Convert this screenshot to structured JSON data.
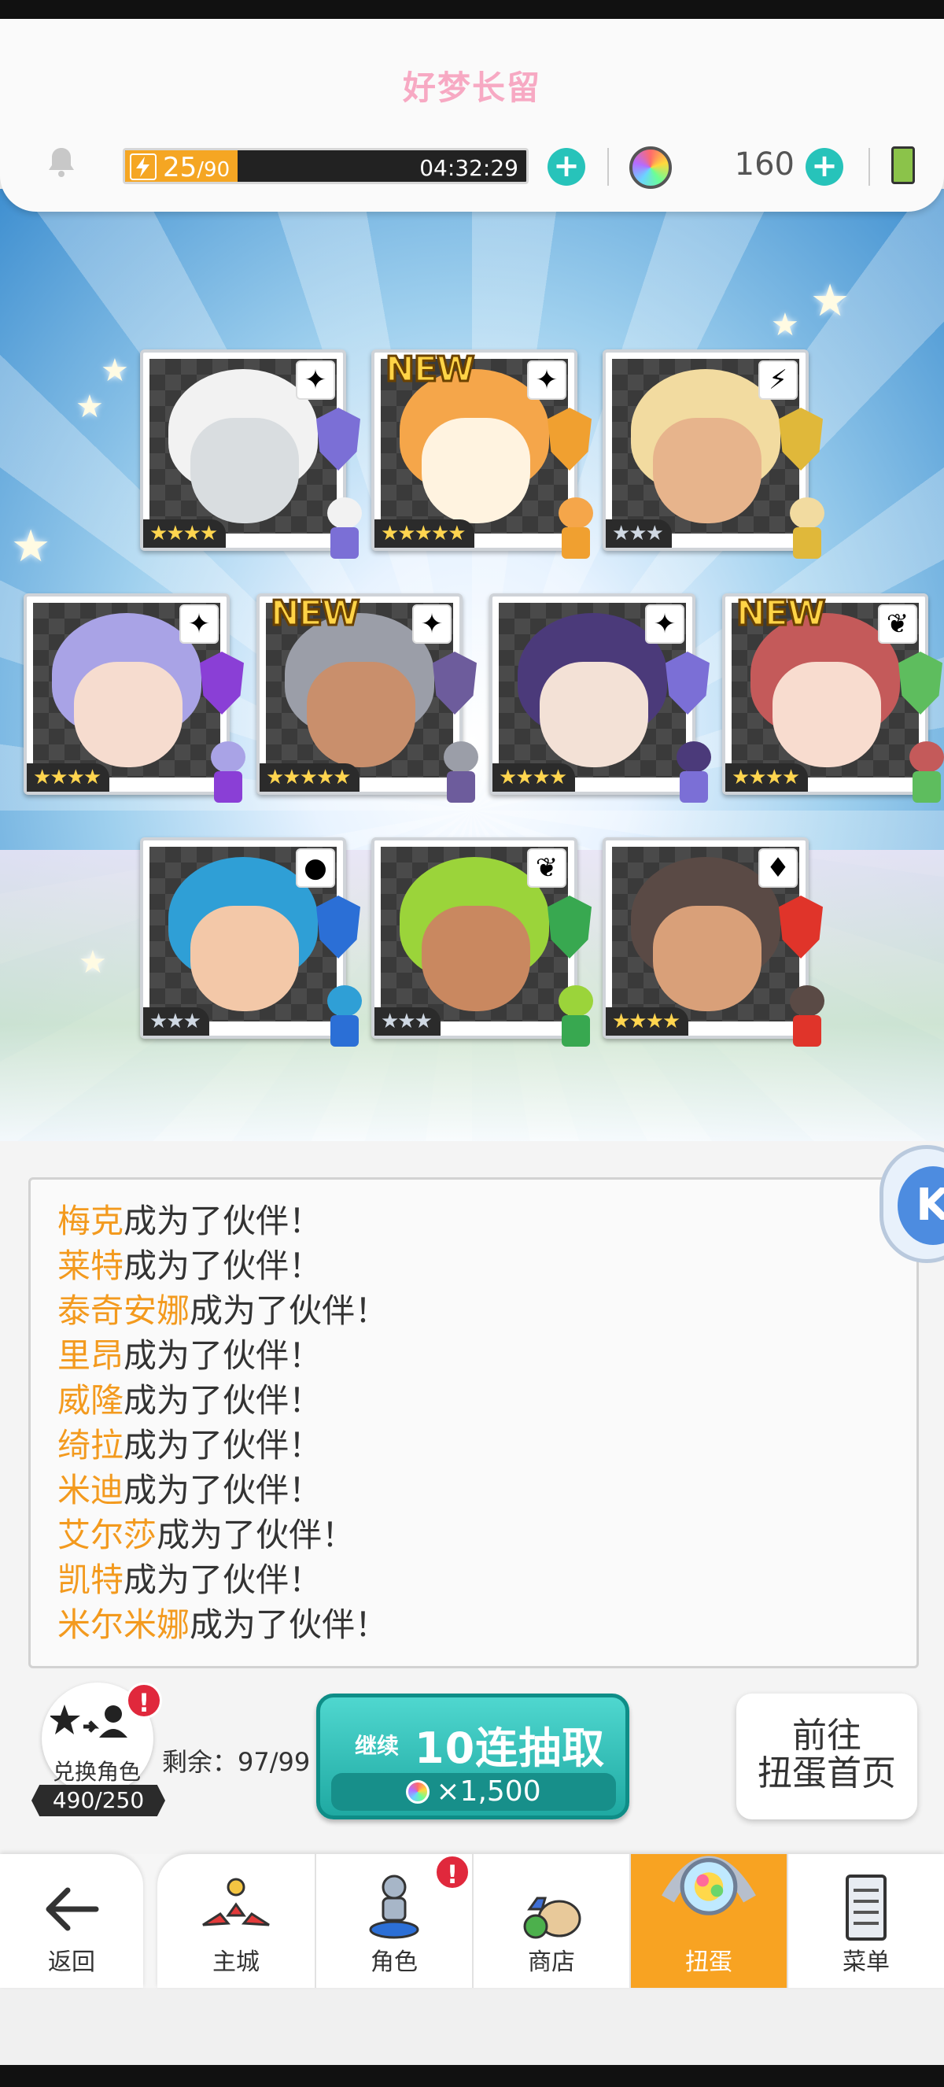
{
  "header": {
    "title": "好梦长留",
    "stamina_value": "25",
    "stamina_max": "/90",
    "stamina_fraction": 0.28,
    "stamina_timer": "04:32:29",
    "gem_count": "160"
  },
  "cards": [
    {
      "stars": "★★★★",
      "new": "",
      "rarity": 4,
      "element": "✦",
      "hair": "#f2f2f2",
      "skin": "#d9dde0",
      "crest": "#7b6fd6"
    },
    {
      "stars": "★★★★★",
      "new": "NEW",
      "rarity": 5,
      "element": "✦",
      "hair": "#f5a64a",
      "skin": "#fff3e0",
      "crest": "#f0a030"
    },
    {
      "stars": "★★★",
      "new": "",
      "rarity": 3,
      "element": "⚡",
      "hair": "#f2dba0",
      "skin": "#e7b48c",
      "crest": "#e0b83a"
    },
    {
      "stars": "★★★★",
      "new": "",
      "rarity": 4,
      "element": "✦",
      "hair": "#a9a3e6",
      "skin": "#f6dccf",
      "crest": "#8a3fd6"
    },
    {
      "stars": "★★★★★",
      "new": "NEW",
      "rarity": 5,
      "element": "✦",
      "hair": "#9b9ea8",
      "skin": "#c98f6c",
      "crest": "#6d5c9c"
    },
    {
      "stars": "★★★★",
      "new": "",
      "rarity": 4,
      "element": "✦",
      "hair": "#4b3a7a",
      "skin": "#f3e1d6",
      "crest": "#7b6fd6"
    },
    {
      "stars": "★★★★",
      "new": "NEW",
      "rarity": 4,
      "element": "❦",
      "hair": "#c45a5a",
      "skin": "#f8dccf",
      "crest": "#5ebd5e"
    },
    {
      "stars": "★★★",
      "new": "",
      "rarity": 3,
      "element": "●",
      "hair": "#2f9fd6",
      "skin": "#f3c8a8",
      "crest": "#2b6fd6"
    },
    {
      "stars": "★★★",
      "new": "",
      "rarity": 3,
      "element": "❦",
      "hair": "#9bd43a",
      "skin": "#c98860",
      "crest": "#38a850"
    },
    {
      "stars": "★★★★",
      "new": "",
      "rarity": 4,
      "element": "♦",
      "hair": "#5a4a45",
      "skin": "#d9a079",
      "crest": "#e0342a"
    }
  ],
  "log": [
    {
      "name": "梅克",
      "suffix": "成为了伙伴！"
    },
    {
      "name": "莱特",
      "suffix": "成为了伙伴！"
    },
    {
      "name": "泰奇安娜",
      "suffix": "成为了伙伴！"
    },
    {
      "name": "里昂",
      "suffix": "成为了伙伴！"
    },
    {
      "name": "威隆",
      "suffix": "成为了伙伴！"
    },
    {
      "name": "绮拉",
      "suffix": "成为了伙伴！"
    },
    {
      "name": "米迪",
      "suffix": "成为了伙伴！"
    },
    {
      "name": "艾尔莎",
      "suffix": "成为了伙伴！"
    },
    {
      "name": "凯特",
      "suffix": "成为了伙伴！"
    },
    {
      "name": "米尔米娜",
      "suffix": "成为了伙伴！"
    }
  ],
  "side_button_letter": "K",
  "controls": {
    "exchange_label": "兑换角色",
    "exchange_count": "490/250",
    "exchange_badge": "!",
    "remaining": "剩余：97/99",
    "gacha_prefix": "继续",
    "gacha_title": "10连抽取",
    "gacha_cost": "×1,500",
    "goto_line1": "前往",
    "goto_line2": "扭蛋首页"
  },
  "nav": {
    "back": "返回",
    "items": [
      {
        "label": "主城",
        "icon": "castle-icon",
        "badge": ""
      },
      {
        "label": "角色",
        "icon": "character-icon",
        "badge": "!"
      },
      {
        "label": "商店",
        "icon": "shop-icon",
        "badge": ""
      },
      {
        "label": "扭蛋",
        "icon": "gacha-icon",
        "badge": "",
        "active": true
      },
      {
        "label": "菜单",
        "icon": "menu-icon",
        "badge": ""
      }
    ]
  },
  "colors": {
    "accent_orange": "#f8a322",
    "teal_button": "#27c3ba",
    "name_orange": "#f39a1e",
    "title_pink": "#f7a9c3"
  }
}
